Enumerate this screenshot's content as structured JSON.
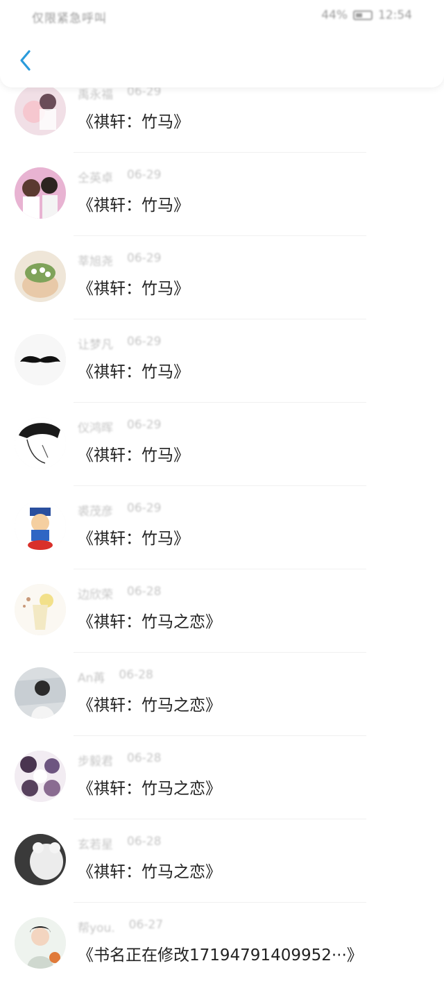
{
  "status_bar": {
    "carrier": "仅限紧急呼叫",
    "battery": "44%",
    "battery_level": 0.44,
    "time": "12:54"
  },
  "header": {
    "back_icon": "chevron-left-icon"
  },
  "colors": {
    "accent": "#2a9bdb",
    "meta_text": "#c5c5c5",
    "message_text": "#222222"
  },
  "items": [
    {
      "name": "禹永福",
      "date": "06-29",
      "message": "《祺轩：竹马》"
    },
    {
      "name": "仝英卓",
      "date": "06-29",
      "message": "《祺轩：竹马》"
    },
    {
      "name": "莘旭尧",
      "date": "06-29",
      "message": "《祺轩：竹马》"
    },
    {
      "name": "让梦凡",
      "date": "06-29",
      "message": "《祺轩：竹马》"
    },
    {
      "name": "仪鸿晖",
      "date": "06-29",
      "message": "《祺轩：竹马》"
    },
    {
      "name": "裘茂彦",
      "date": "06-29",
      "message": "《祺轩：竹马》"
    },
    {
      "name": "边欣荣",
      "date": "06-28",
      "message": "《祺轩：竹马之恋》"
    },
    {
      "name": "An苒",
      "date": "06-28",
      "message": "《祺轩：竹马之恋》"
    },
    {
      "name": "步毅君",
      "date": "06-28",
      "message": "《祺轩：竹马之恋》"
    },
    {
      "name": "玄若星",
      "date": "06-28",
      "message": "《祺轩：竹马之恋》"
    },
    {
      "name": "帮you.",
      "date": "06-27",
      "message": "《书名正在修改17194791409952···》"
    }
  ]
}
